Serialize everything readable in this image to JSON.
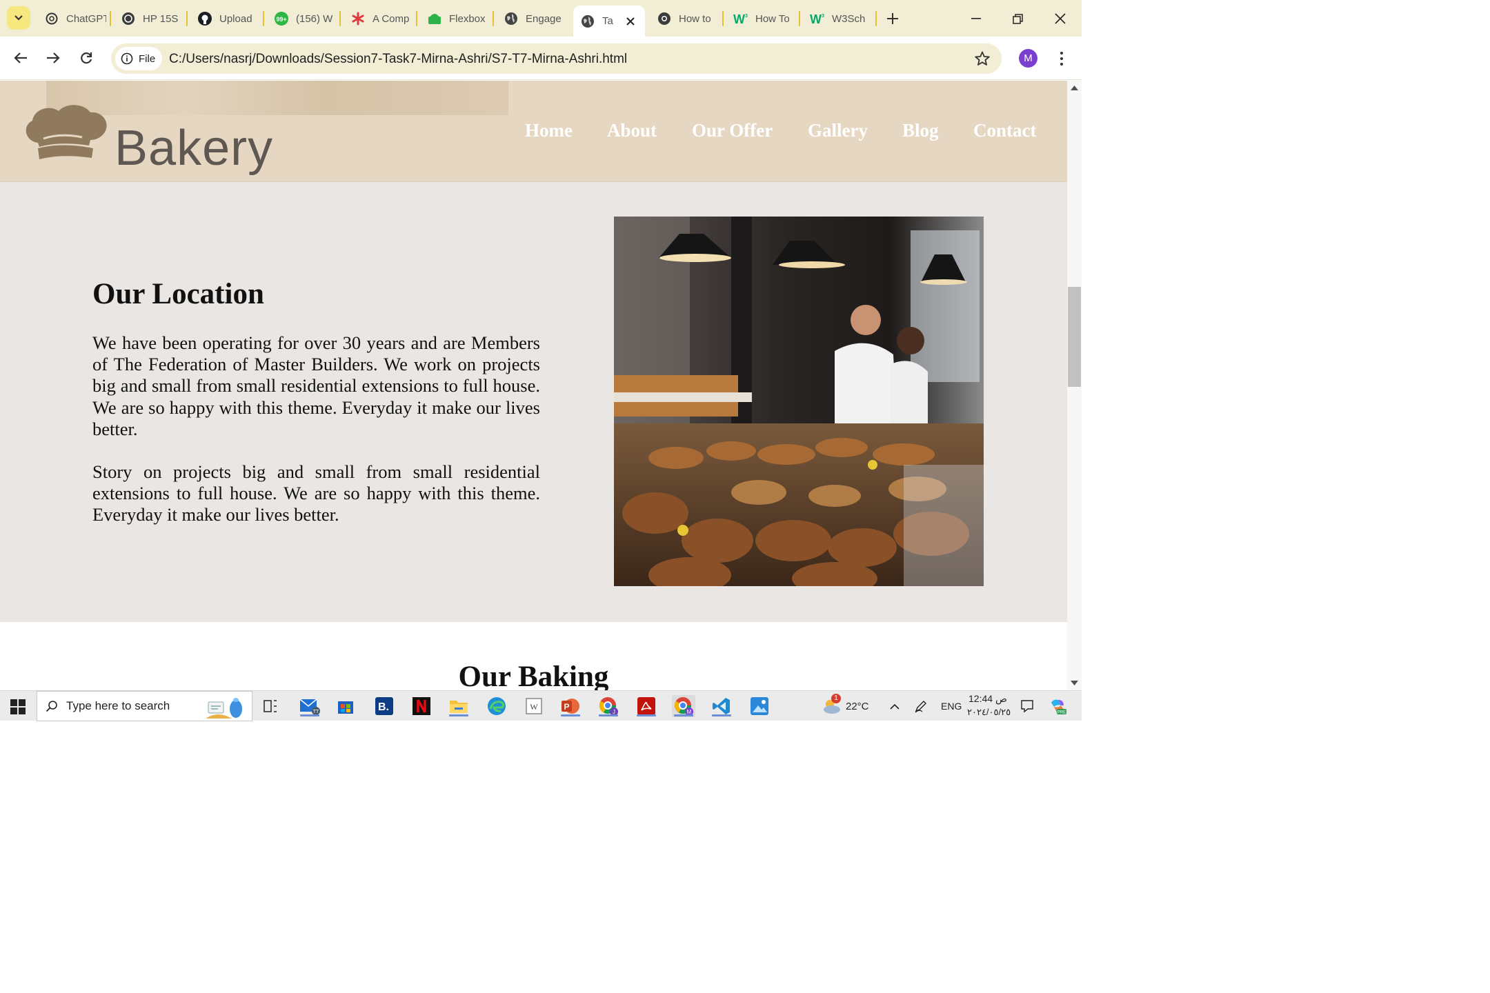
{
  "browser": {
    "tabs": [
      {
        "label": "ChatGPT",
        "icon": "chatgpt-icon"
      },
      {
        "label": "HP 15S",
        "icon": "hp-icon"
      },
      {
        "label": "Upload",
        "icon": "github-icon"
      },
      {
        "label": "(156) W",
        "icon": "whatsapp-icon"
      },
      {
        "label": "A Comp",
        "icon": "asterisk-icon"
      },
      {
        "label": "Flexbox",
        "icon": "android-icon"
      },
      {
        "label": "Engage",
        "icon": "globe-icon"
      },
      {
        "label": "Ta",
        "icon": "globe-icon",
        "active": true
      },
      {
        "label": "How to",
        "icon": "chrome-icon"
      },
      {
        "label": "How To",
        "icon": "w3schools-icon"
      },
      {
        "label": "W3Sch",
        "icon": "w3schools-icon"
      }
    ],
    "address": {
      "scheme_label": "File",
      "url": "C:/Users/nasrj/Downloads/Session7-Task7-Mirna-Ashri/S7-T7-Mirna-Ashri.html"
    },
    "profile_initial": "M"
  },
  "site": {
    "logo_text": "Bakery",
    "nav": [
      "Home",
      "About",
      "Our Offer",
      "Gallery",
      "Blog",
      "Contact"
    ],
    "location": {
      "title": "Our Location",
      "paragraphs": [
        "We have been operating for over 30 years and are Members of The Federation of Master Builders. We work on projects big and small from small residential extensions to full house. We are so happy with this theme. Everyday it make our lives better.",
        "Story on projects big and small from small residential extensions to full house. We are so happy with this theme. Everyday it make our lives better."
      ]
    },
    "baking_title": "Our Baking"
  },
  "taskbar": {
    "search_placeholder": "Type here to search",
    "weather": "22°C",
    "weather_badge": "1",
    "language": "ENG",
    "time": "12:44 ص",
    "date": "٢٠٢٤/٠٥/٢٥"
  },
  "colors": {
    "header_bg": "#e6d7c3",
    "section_bg": "#e9e6e3",
    "tab_strip": "#f1eed5",
    "tab_separator": "#e4c233"
  }
}
